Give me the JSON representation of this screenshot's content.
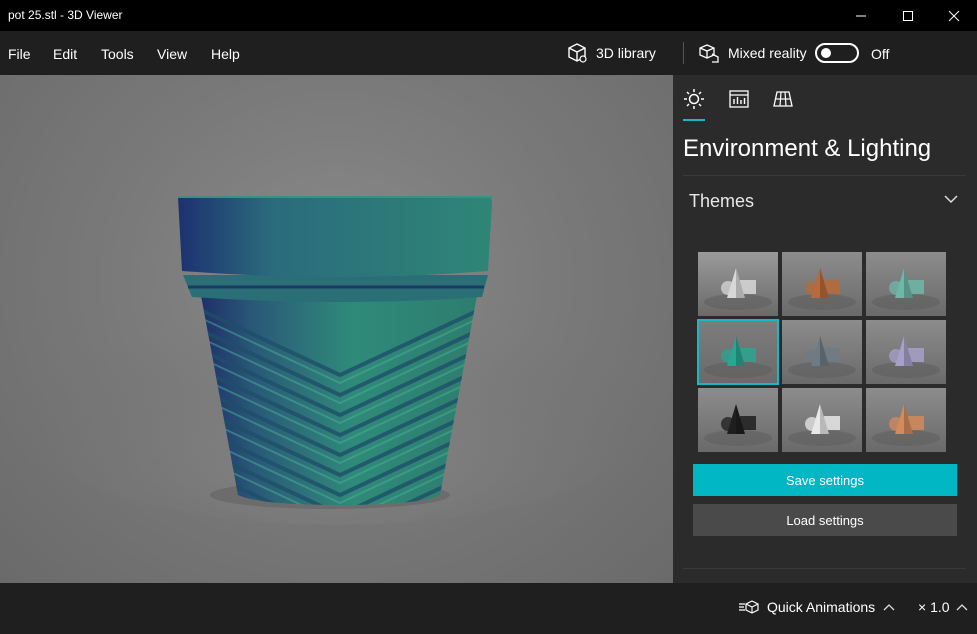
{
  "window": {
    "title": "pot 25.stl - 3D Viewer"
  },
  "menu": {
    "items": [
      "File",
      "Edit",
      "Tools",
      "View",
      "Help"
    ]
  },
  "toolbar": {
    "library_label": "3D library",
    "mixed_reality_label": "Mixed reality",
    "mixed_reality_state": "Off"
  },
  "panel": {
    "tabs": [
      "sun-icon",
      "stats-icon",
      "grid-icon"
    ],
    "title": "Environment & Lighting",
    "themes_label": "Themes",
    "selected_theme": 4,
    "themes": [
      {
        "name": "theme-light-gray",
        "shape_color": "#d8d8d8",
        "bg": "#9a9a9a"
      },
      {
        "name": "theme-dark-orange",
        "shape_color": "#b86a3a",
        "bg": "#8c8c8c"
      },
      {
        "name": "theme-teal-light",
        "shape_color": "#6fb7a8",
        "bg": "#8c8c8c"
      },
      {
        "name": "theme-teal",
        "shape_color": "#2aa58f",
        "bg": "#7d7d7d"
      },
      {
        "name": "theme-slate",
        "shape_color": "#6e7b85",
        "bg": "#8c8c8c"
      },
      {
        "name": "theme-lavender",
        "shape_color": "#a7a0c8",
        "bg": "#8c8c8c"
      },
      {
        "name": "theme-dark",
        "shape_color": "#1e1e1e",
        "bg": "#8c8c8c"
      },
      {
        "name": "theme-white",
        "shape_color": "#e8e8e8",
        "bg": "#8c8c8c"
      },
      {
        "name": "theme-sunset",
        "shape_color": "#d48a5a",
        "bg": "#8c8c8c"
      }
    ],
    "save_label": "Save settings",
    "load_label": "Load settings"
  },
  "bottom": {
    "quick_animations_label": "Quick Animations",
    "speed_label": "× 1.0"
  },
  "colors": {
    "accent": "#00b7c3",
    "model": "#2f8a7a"
  }
}
